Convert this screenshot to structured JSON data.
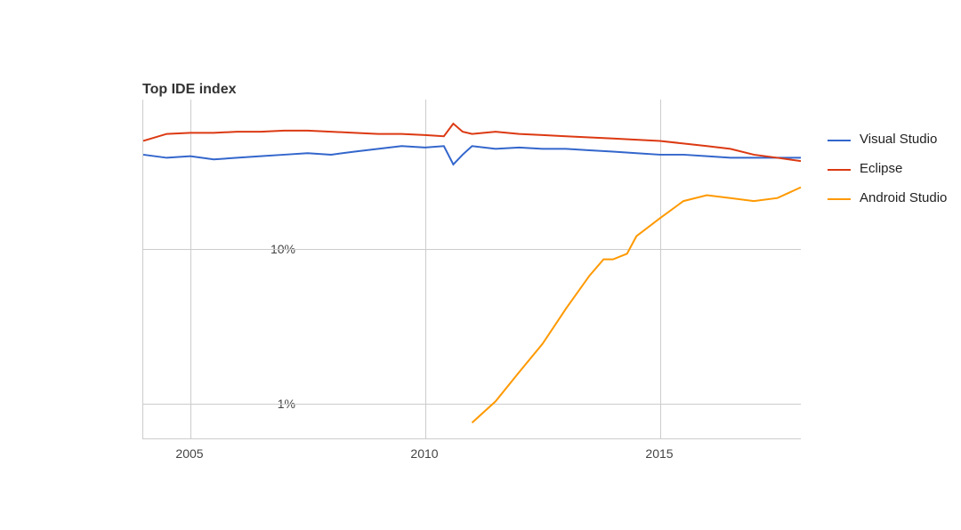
{
  "chart_data": {
    "type": "line",
    "title": "Top IDE index",
    "xlabel": "",
    "ylabel": "",
    "yscale": "log",
    "y_ticks": [
      "1%",
      "10%"
    ],
    "y_tick_values": [
      1,
      10
    ],
    "x_ticks": [
      "2005",
      "2010",
      "2015"
    ],
    "x_tick_values": [
      2005,
      2010,
      2015
    ],
    "xlim": [
      2004,
      2018
    ],
    "ylim_log10": [
      -0.5,
      1.7
    ],
    "colors": {
      "Visual Studio": "#3366cc",
      "Eclipse": "#dc3912",
      "Android Studio": "#ff9900"
    },
    "legend": [
      "Visual Studio",
      "Eclipse",
      "Android Studio"
    ],
    "series": [
      {
        "name": "Visual Studio",
        "x": [
          2004.0,
          2004.5,
          2005.0,
          2005.5,
          2006.0,
          2006.5,
          2007.0,
          2007.5,
          2008.0,
          2008.5,
          2009.0,
          2009.5,
          2010.0,
          2010.4,
          2010.6,
          2010.8,
          2011.0,
          2011.5,
          2012.0,
          2012.5,
          2013.0,
          2013.5,
          2014.0,
          2014.5,
          2015.0,
          2015.5,
          2016.0,
          2016.5,
          2017.0,
          2017.5,
          2018.0
        ],
        "values": [
          22.0,
          21.0,
          21.5,
          20.5,
          21.0,
          21.5,
          22.0,
          22.5,
          22.0,
          23.0,
          24.0,
          25.0,
          24.5,
          25.0,
          19.0,
          22.0,
          25.0,
          24.0,
          24.5,
          24.0,
          24.0,
          23.5,
          23.0,
          22.5,
          22.0,
          22.0,
          21.5,
          21.0,
          21.0,
          21.0,
          21.0
        ]
      },
      {
        "name": "Eclipse",
        "x": [
          2004.0,
          2004.5,
          2005.0,
          2005.5,
          2006.0,
          2006.5,
          2007.0,
          2007.5,
          2008.0,
          2008.5,
          2009.0,
          2009.5,
          2010.0,
          2010.4,
          2010.6,
          2010.8,
          2011.0,
          2011.5,
          2012.0,
          2012.5,
          2013.0,
          2013.5,
          2014.0,
          2014.5,
          2015.0,
          2015.5,
          2016.0,
          2016.5,
          2017.0,
          2017.5,
          2018.0
        ],
        "values": [
          27.0,
          30.0,
          30.5,
          30.5,
          31.0,
          31.0,
          31.5,
          31.5,
          31.0,
          30.5,
          30.0,
          30.0,
          29.5,
          29.0,
          35.0,
          31.0,
          30.0,
          31.0,
          30.0,
          29.5,
          29.0,
          28.5,
          28.0,
          27.5,
          27.0,
          26.0,
          25.0,
          24.0,
          22.0,
          21.0,
          20.0
        ]
      },
      {
        "name": "Android Studio",
        "x": [
          2011.0,
          2011.5,
          2012.0,
          2012.5,
          2013.0,
          2013.5,
          2013.8,
          2014.0,
          2014.3,
          2014.5,
          2015.0,
          2015.5,
          2016.0,
          2016.5,
          2017.0,
          2017.5,
          2018.0
        ],
        "values": [
          0.4,
          0.55,
          0.85,
          1.3,
          2.2,
          3.6,
          4.6,
          4.6,
          5.0,
          6.5,
          8.5,
          11.0,
          12.0,
          11.5,
          11.0,
          11.5,
          13.5
        ]
      }
    ]
  }
}
